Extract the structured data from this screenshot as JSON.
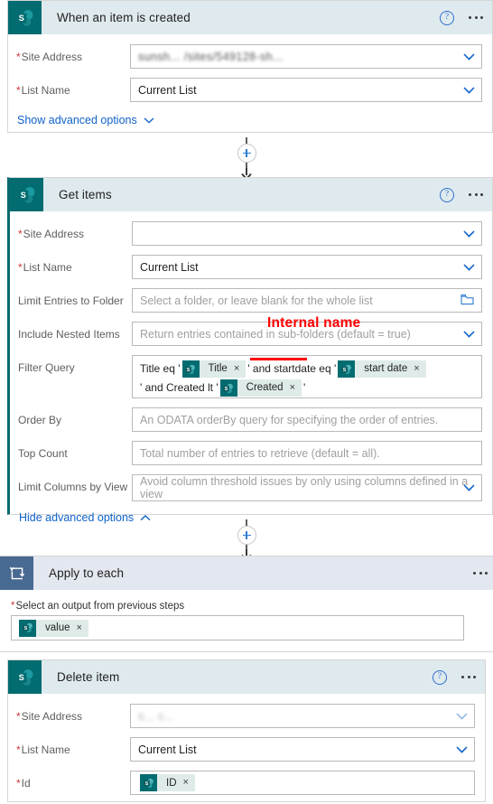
{
  "flow": {
    "steps": [
      {
        "id": "trigger",
        "title": "When an item is created",
        "connector_icon": "sharepoint-icon",
        "help_icon": "help-icon",
        "more_icon": "more-options-icon",
        "fields": [
          {
            "label": "Site Address",
            "required": true,
            "value": "sunsh... /sites/549128-sh...",
            "obscured": true,
            "control": "dropdown"
          },
          {
            "label": "List Name",
            "required": true,
            "value": "Current List",
            "obscured": false,
            "control": "dropdown"
          }
        ],
        "advanced_link": "Show advanced options",
        "advanced_chevron": "chevron-down-icon"
      },
      {
        "id": "get-items",
        "title": "Get items",
        "connector_icon": "sharepoint-icon",
        "help_icon": "help-icon",
        "more_icon": "more-options-icon",
        "selected": true,
        "fields": [
          {
            "label": "Site Address",
            "required": true,
            "value": "",
            "obscured": true,
            "control": "dropdown"
          },
          {
            "label": "List Name",
            "required": true,
            "value": "Current List",
            "obscured": false,
            "control": "dropdown"
          },
          {
            "label": "Limit Entries to Folder",
            "required": false,
            "placeholder": "Select a folder, or leave blank for the whole list",
            "control": "folder-picker"
          },
          {
            "label": "Include Nested Items",
            "required": false,
            "placeholder": "Return entries contained in sub-folders (default = true)",
            "control": "dropdown"
          },
          {
            "label": "Filter Query",
            "required": false,
            "control": "token-editor"
          },
          {
            "label": "Order By",
            "required": false,
            "placeholder": "An ODATA orderBy query for specifying the order of entries.",
            "control": "text"
          },
          {
            "label": "Top Count",
            "required": false,
            "placeholder": "Total number of entries to retrieve (default = all).",
            "control": "text"
          },
          {
            "label": "Limit Columns by View",
            "required": false,
            "placeholder": "Avoid column threshold issues by only using columns defined in a view",
            "control": "dropdown"
          }
        ],
        "filter_query": {
          "parts": [
            {
              "type": "text",
              "text": "Title eq '"
            },
            {
              "type": "token",
              "label": "Title",
              "icon": "sharepoint-icon",
              "remove": "×"
            },
            {
              "type": "text",
              "text": "' and startdate eq '"
            },
            {
              "type": "token",
              "label": "start date",
              "icon": "sharepoint-icon",
              "remove": "×"
            },
            {
              "type": "text",
              "text": "' and Created lt '"
            },
            {
              "type": "token",
              "label": "Created",
              "icon": "sharepoint-icon",
              "remove": "×"
            },
            {
              "type": "text",
              "text": "'"
            }
          ]
        },
        "advanced_link": "Hide advanced options",
        "advanced_chevron": "chevron-up-icon"
      },
      {
        "id": "apply-to-each",
        "title": "Apply to each",
        "connector_icon": "loop-icon",
        "more_icon": "more-options-icon",
        "subtitle": "Select an output from previous steps",
        "subtitle_required": true,
        "token": {
          "label": "value",
          "icon": "sharepoint-icon",
          "remove": "×"
        }
      },
      {
        "id": "delete-item",
        "title": "Delete item",
        "connector_icon": "sharepoint-icon",
        "help_icon": "help-icon",
        "more_icon": "more-options-icon",
        "fields": [
          {
            "label": "Site Address",
            "required": true,
            "value": "s... c...",
            "obscured": true,
            "control": "dropdown"
          },
          {
            "label": "List Name",
            "required": true,
            "value": "Current List",
            "obscured": false,
            "control": "dropdown"
          },
          {
            "label": "Id",
            "required": true,
            "control": "token-editor"
          }
        ],
        "id_token": {
          "label": "ID",
          "icon": "sharepoint-icon",
          "remove": "×"
        }
      }
    ],
    "connectors": [
      {
        "plus_label": "+",
        "arrow": "arrow-down-icon"
      },
      {
        "plus_label": "+",
        "arrow": "arrow-down-icon"
      }
    ],
    "annotation": {
      "text": "Internal name",
      "color": "#ff0000",
      "underline_target": "startdate"
    }
  }
}
